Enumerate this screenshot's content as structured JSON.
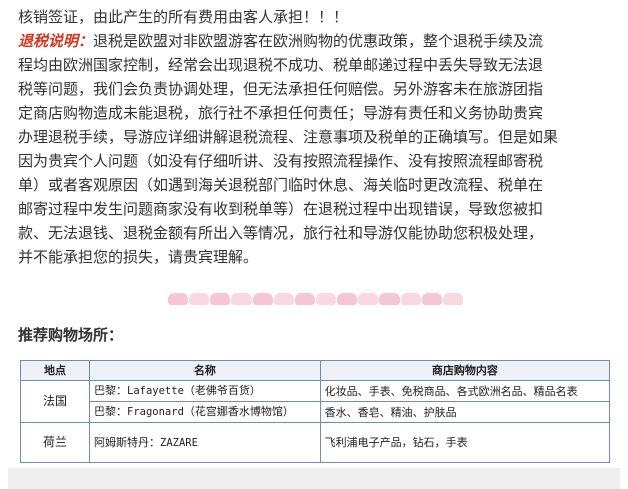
{
  "notice_line": "核销签证，由此产生的所有费用由客人承担！！！",
  "tax_refund": {
    "heading": "退税说明：",
    "lines": [
      "退税是欧盟对非欧盟游客在欧洲购物的优惠政策，整个退税手续及流",
      "程均由欧洲国家控制，经常会出现退税不成功、税单邮递过程中丢失导致无法退",
      "税等问题，我们会负责协调处理，但无法承担任何赔偿。另外游客未在旅游团指",
      "定商店购物造成未能退税，旅行社不承担任何责任；导游有责任和义务协助贵宾",
      "办理退税手续，导游应详细讲解退税流程、注意事项及税单的正确填写。但是如果",
      "因为贵宾个人问题（如没有仔细听讲、没有按照流程操作、没有按照流程邮寄税",
      "单）或者客观原因（如遇到海关退税部门临时休息、海关临时更改流程、税单在",
      "邮寄过程中发生问题商家没有收到税单等）在退税过程中出现错误，导致您被扣",
      "款、无法退钱、退税金额有所出入等情况，旅行社和导游仅能协助您积极处理，",
      "并不能承担您的损失，请贵宾理解。"
    ]
  },
  "divider_colors": [
    "#f5c6d6",
    "#f9d8e2",
    "#f5c6d6",
    "#f9d8e2",
    "#f5c6d6",
    "#f9d8e2",
    "#f5c6d6",
    "#f9d8e2",
    "#f5c6d6",
    "#f9d8e2",
    "#f5c6d6",
    "#f9d8e2",
    "#f5c6d6",
    "#f9d8e2"
  ],
  "shopping_title": "推荐购物场所：",
  "table": {
    "headers": [
      "地点",
      "名称",
      "商店购物内容"
    ],
    "rows": [
      {
        "country": "法国",
        "name_prefix": "巴黎：",
        "name_latin": "Lafayette",
        "name_suffix": "（老佛爷百货）",
        "content": "化妆品、手表、免税商品、各式欧洲名品、精品名表"
      },
      {
        "name_prefix": "巴黎：",
        "name_latin": "Fragonard",
        "name_suffix": "（花宫娜香水博物馆）",
        "content": "香水、香皂、精油、护肤品"
      },
      {
        "country": "荷兰",
        "name_prefix": "阿姆斯特丹：",
        "name_latin": "ZAZARE",
        "name_suffix": "",
        "content": "飞利浦电子产品，钻石，手表"
      }
    ]
  },
  "colors": {
    "accent_red": "#d6361f",
    "table_border": "#6b8fb3"
  }
}
